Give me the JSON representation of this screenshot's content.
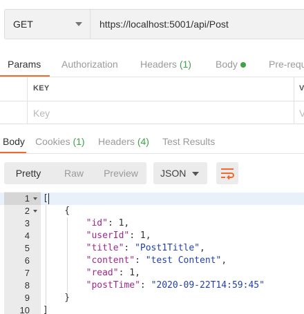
{
  "request": {
    "method": "GET",
    "url": "https://localhost:5001/api/Post"
  },
  "request_tabs": [
    {
      "label": "Params",
      "count": "",
      "active": true
    },
    {
      "label": "Authorization",
      "count": "",
      "active": false
    },
    {
      "label": "Headers",
      "count": "(1)",
      "active": false
    },
    {
      "label": "Body",
      "count": "",
      "active": false
    },
    {
      "label": "Pre-requ",
      "count": "",
      "active": false
    }
  ],
  "body_indicator_color": "#3fa14a",
  "accent_color": "#f06b2b",
  "params_table": {
    "headers": {
      "key": "KEY",
      "next": "V"
    },
    "placeholder_key": "Key",
    "placeholder_next": "V"
  },
  "response_tabs": [
    {
      "label": "Body",
      "count": "",
      "active": true
    },
    {
      "label": "Cookies",
      "count": "(1)",
      "active": false
    },
    {
      "label": "Headers",
      "count": "(4)",
      "active": false
    },
    {
      "label": "Test Results",
      "count": "",
      "active": false
    }
  ],
  "view_modes": [
    "Pretty",
    "Raw",
    "Preview"
  ],
  "active_view_mode": "Pretty",
  "format": "JSON",
  "icons": {
    "method_dropdown": "chevron-down-icon",
    "format_dropdown": "chevron-down-icon",
    "wrap": "wrap-lines-icon",
    "fold": "fold-arrow-icon"
  },
  "response_lines": [
    {
      "num": "1",
      "fold": true,
      "text": "["
    },
    {
      "num": "2",
      "fold": true,
      "text": "    {"
    },
    {
      "num": "3",
      "fold": false,
      "text": "        \"id\": 1,"
    },
    {
      "num": "4",
      "fold": false,
      "text": "        \"userId\": 1,"
    },
    {
      "num": "5",
      "fold": false,
      "text": "        \"title\": \"Post1Title\","
    },
    {
      "num": "6",
      "fold": false,
      "text": "        \"content\": \"test Content\","
    },
    {
      "num": "7",
      "fold": false,
      "text": "        \"read\": 1,"
    },
    {
      "num": "8",
      "fold": false,
      "text": "        \"postTime\": \"2020-09-22T14:59:45\""
    },
    {
      "num": "9",
      "fold": false,
      "text": "    }"
    },
    {
      "num": "10",
      "fold": false,
      "text": "]"
    }
  ]
}
